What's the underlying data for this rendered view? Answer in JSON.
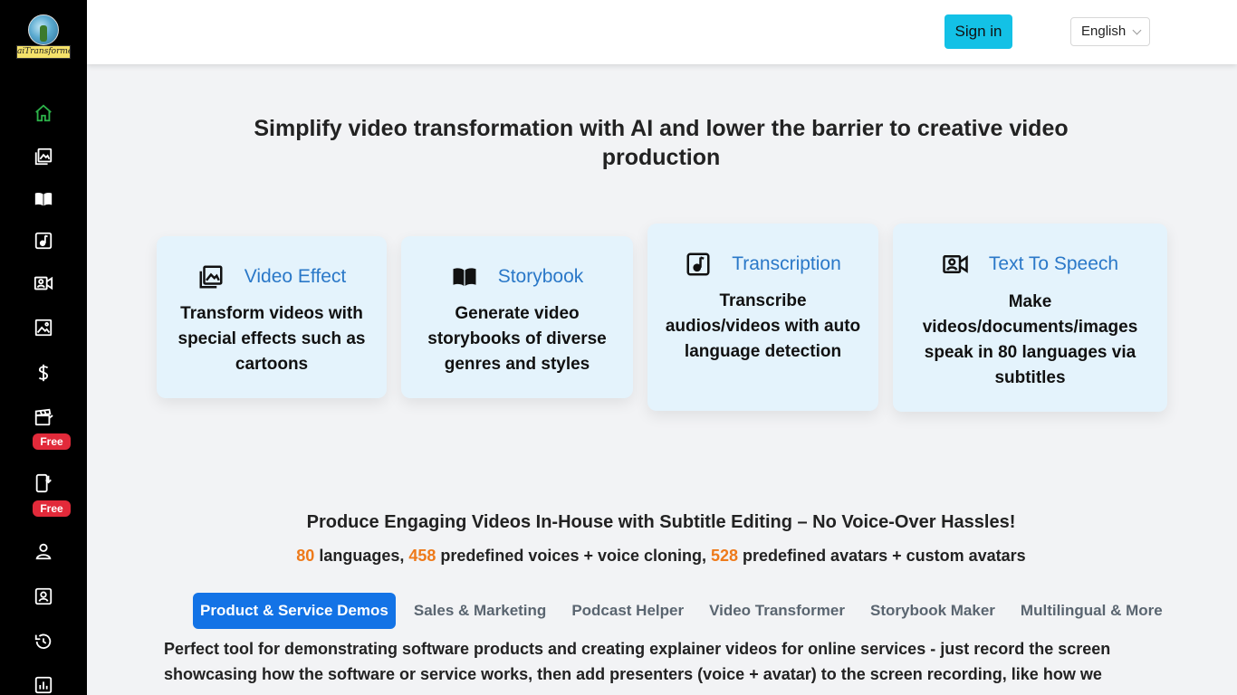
{
  "brand": {
    "logo_text": "aiTransformer"
  },
  "sidebar": {
    "items": [
      {
        "icon": "home-icon",
        "color": "#2db34a"
      },
      {
        "icon": "images-icon"
      },
      {
        "icon": "book-icon"
      },
      {
        "icon": "music-icon"
      },
      {
        "icon": "video-person-icon"
      },
      {
        "icon": "image-icon"
      },
      {
        "icon": "dollar-icon"
      },
      {
        "icon": "clapperboard-icon",
        "badge": "Free"
      },
      {
        "icon": "phone-download-icon",
        "badge": "Free"
      },
      {
        "icon": "user-icon"
      },
      {
        "icon": "user-badge-icon"
      },
      {
        "icon": "history-icon"
      },
      {
        "icon": "chart-icon"
      }
    ]
  },
  "header": {
    "signin_label": "Sign in",
    "language": "English"
  },
  "hero": {
    "title": "Simplify video transformation with AI and lower the barrier to creative video production"
  },
  "cards": [
    {
      "title": "Video Effect",
      "desc": "Transform videos with special effects such as cartoons",
      "icon": "images-icon"
    },
    {
      "title": "Storybook",
      "desc": "Generate video storybooks of diverse genres and styles",
      "icon": "book-icon"
    },
    {
      "title": "Transcription",
      "desc": "Transcribe audios/videos with auto language detection",
      "icon": "music-icon"
    },
    {
      "title": "Text To Speech",
      "desc": "Make videos/documents/images speak in 80 languages via subtitles",
      "icon": "video-person-icon"
    }
  ],
  "section": {
    "headline": "Produce Engaging Videos In-House with Subtitle Editing – No Voice-Over Hassles!",
    "stats": {
      "languages_num": "80",
      "languages_text": " languages, ",
      "voices_num": "458",
      "voices_text": " predefined voices + voice cloning, ",
      "avatars_num": "528",
      "avatars_text": " predefined avatars + custom avatars"
    },
    "tabs": [
      "Product & Service Demos",
      "Sales & Marketing",
      "Podcast Helper",
      "Video Transformer",
      "Storybook Maker",
      "Multilingual & More"
    ],
    "description": "Perfect tool for demonstrating software products and creating explainer videos for online services - just record the screen showcasing how the software or service works, then add presenters (voice + avatar) to the screen recording, like how we"
  },
  "colors": {
    "accent": "#13c1e6",
    "tab_active": "#1373e6",
    "card_title": "#2a78c8",
    "stat_number": "#ee7a1a",
    "badge": "#e22a3a"
  }
}
